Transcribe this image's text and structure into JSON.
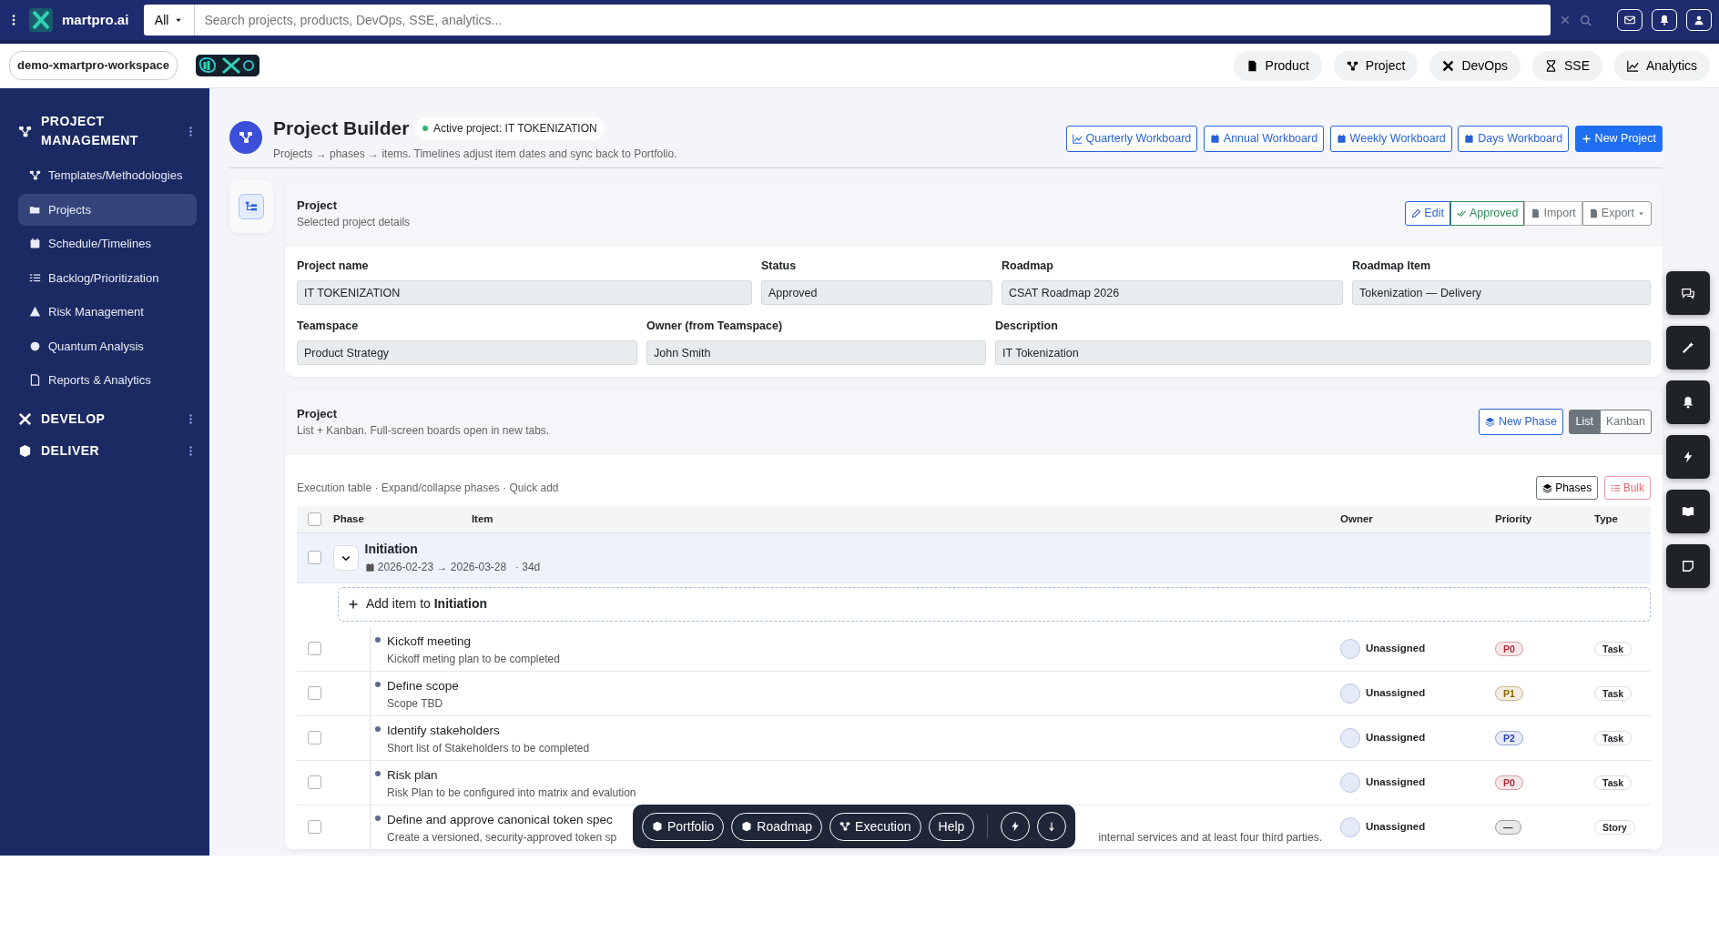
{
  "topbar": {
    "brand": "martpro.ai",
    "search_scope": "All",
    "search": {
      "placeholder": "Search projects, products, DevOps, SSE, analytics..."
    }
  },
  "workspace": "demo-xmartpro-workspace",
  "modules": [
    {
      "label": "Product",
      "kind": "product"
    },
    {
      "label": "Project",
      "kind": "project"
    },
    {
      "label": "DevOps",
      "kind": "devops"
    },
    {
      "label": "SSE",
      "kind": "sse"
    },
    {
      "label": "Analytics",
      "kind": "analytics"
    }
  ],
  "sidebar": {
    "sections": [
      {
        "title": "PROJECT MANAGEMENT",
        "items": [
          {
            "label": "Templates/Methodologies",
            "selected": false
          },
          {
            "label": "Projects",
            "selected": true
          },
          {
            "label": "Schedule/Timelines",
            "selected": false
          },
          {
            "label": "Backlog/Prioritization",
            "selected": false
          },
          {
            "label": "Risk Management",
            "selected": false
          },
          {
            "label": "Quantum Analysis",
            "selected": false
          },
          {
            "label": "Reports & Analytics",
            "selected": false
          }
        ]
      },
      {
        "title": "DEVELOP"
      },
      {
        "title": "DELIVER"
      }
    ]
  },
  "header": {
    "title": "Project Builder",
    "badge": "Active project: IT TOKENIZATION",
    "subtitle": "Projects → phases → items. Timelines adjust item dates and sync back to Portfolio.",
    "buttons": [
      {
        "label": "Quarterly Workboard",
        "kind": "outline"
      },
      {
        "label": "Annual Workboard",
        "kind": "outline"
      },
      {
        "label": "Weekly Workboard",
        "kind": "outline"
      },
      {
        "label": "Days Workboard",
        "kind": "outline"
      },
      {
        "label": "New Project",
        "kind": "primary"
      }
    ]
  },
  "details": {
    "title": "Project",
    "subtitle": "Selected project details",
    "actions": [
      {
        "label": "Edit",
        "kind": "primary"
      },
      {
        "label": "Approved",
        "kind": "success"
      },
      {
        "label": "Import",
        "kind": "muted"
      },
      {
        "label": "Export",
        "kind": "dropdown"
      }
    ],
    "fields_row_1": [
      {
        "label": "Project name",
        "value": "IT TOKENIZATION"
      },
      {
        "label": "Status",
        "value": "Approved"
      },
      {
        "label": "Roadmap",
        "value": "CSAT Roadmap 2026"
      },
      {
        "label": "Roadmap Item",
        "value": "Tokenization — Delivery"
      }
    ],
    "fields_row_2": [
      {
        "label": "Teamspace",
        "value": "Product Strategy"
      },
      {
        "label": "Owner (from Teamspace)",
        "value": "John Smith"
      },
      {
        "label": "Description",
        "value": "IT Tokenization"
      }
    ]
  },
  "board": {
    "title": "Project",
    "subtitle": "List + Kanban. Full-screen boards open in new tabs.",
    "new_phase": "New Phase",
    "views": [
      {
        "label": "List",
        "selected": true
      },
      {
        "label": "Kanban",
        "selected": false
      }
    ],
    "caption": "Execution table · Expand/collapse phases · Quick add",
    "tools": [
      {
        "label": "Phases",
        "kind": "neutral"
      },
      {
        "label": "Bulk",
        "kind": "danger"
      }
    ],
    "select_all": false,
    "columns": [
      "Phase",
      "Item",
      "Owner",
      "Priority",
      "Type"
    ],
    "phases": [
      {
        "name": "Initiation",
        "dates": "2026-02-23 → 2026-03-28",
        "duration": "· 34d",
        "checked": false,
        "expanded": true,
        "add_item": "Add item to **Initiation**",
        "items": [
          {
            "title": "Kickoff meeting",
            "description": "Kickoff meting plan to be completed",
            "owner": "Unassigned",
            "priority": "P0",
            "color": "#b02a37",
            "type": "Task",
            "checked": false
          },
          {
            "title": "Define scope",
            "description": "Scope TBD",
            "owner": "Unassigned",
            "priority": "P1",
            "color": "#8a6500",
            "type": "Task",
            "checked": false
          },
          {
            "title": "Identify stakeholders",
            "description": "Short list of Stakeholders to be completed",
            "owner": "Unassigned",
            "priority": "P2",
            "color": "#2943a8",
            "type": "Task",
            "checked": false
          },
          {
            "title": "Risk plan",
            "description": "Risk Plan to be configured into matrix and evalution",
            "owner": "Unassigned",
            "priority": "P0",
            "color": "#b02a37",
            "type": "Task",
            "checked": false
          },
          {
            "title": "Define and approve canonical token spec",
            "description": "Create a versioned, security-approved token sp",
            "description_tail": "internal services and at least four third parties.",
            "owner": "Unassigned",
            "priority": "—",
            "color": "#333333",
            "type": "Story",
            "checked": false
          }
        ]
      }
    ]
  },
  "quick_bar": [
    "Portfolio",
    "Roadmap",
    "Execution",
    "Help"
  ]
}
